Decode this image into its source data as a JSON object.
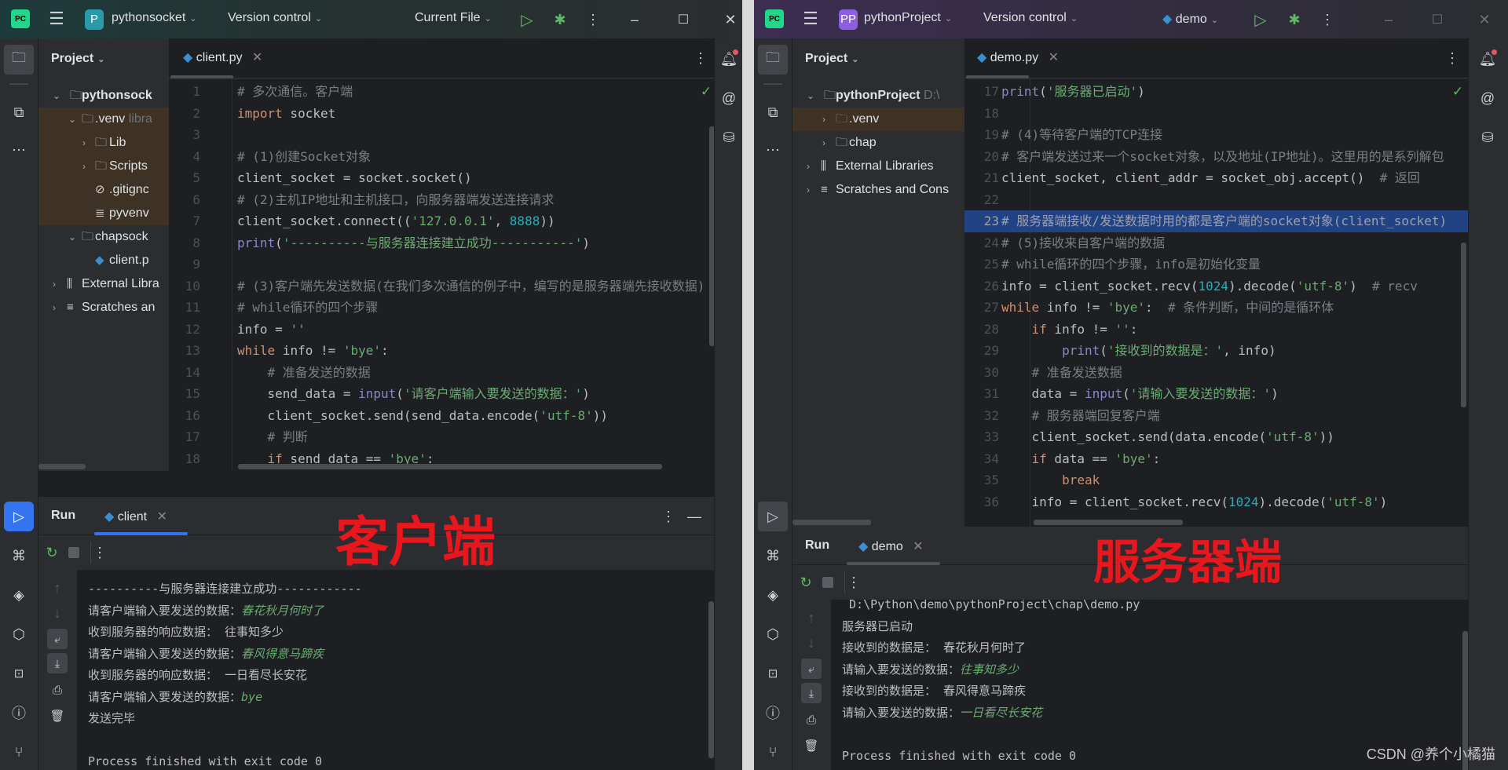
{
  "colors": {
    "keyword": "#cf8e6d",
    "string": "#6aab73",
    "number": "#2aacb8",
    "comment": "#7a7e85",
    "builtin": "#8888c6",
    "annotation": "#e8161d",
    "selection": "#214283"
  },
  "left": {
    "title": {
      "project_badge": "P",
      "project": "pythonsocket",
      "vcs": "Version control",
      "run_config": "Current File"
    },
    "project_panel": {
      "title": "Project",
      "items": [
        {
          "label": "pythonsock",
          "extra": "",
          "icon": "folder-icon"
        },
        {
          "label": ".venv",
          "extra": "libra",
          "icon": "folder-icon"
        },
        {
          "label": "Lib",
          "extra": "",
          "icon": "folder-icon"
        },
        {
          "label": "Scripts",
          "extra": "",
          "icon": "folder-icon"
        },
        {
          "label": ".gitignc",
          "extra": "",
          "icon": "ignore-file-icon"
        },
        {
          "label": "pyvenv",
          "extra": "",
          "icon": "text-file-icon"
        },
        {
          "label": "chapsock",
          "extra": "",
          "icon": "folder-icon"
        },
        {
          "label": "client.p",
          "extra": "",
          "icon": "python-file-icon"
        },
        {
          "label": "External Libra",
          "extra": "",
          "icon": "library-icon"
        },
        {
          "label": "Scratches an",
          "extra": "",
          "icon": "scratches-icon"
        }
      ]
    },
    "tab": "client.py",
    "code": [
      {
        "n": "1",
        "t": [
          [
            "# 多次通信。客户端",
            "cm"
          ]
        ]
      },
      {
        "n": "2",
        "t": [
          [
            "import",
            "kw"
          ],
          [
            " socket",
            ""
          ]
        ]
      },
      {
        "n": "3",
        "t": []
      },
      {
        "n": "4",
        "t": [
          [
            "# (1)创建Socket对象",
            "cm"
          ]
        ]
      },
      {
        "n": "5",
        "t": [
          [
            "client_socket = socket.socket()",
            ""
          ]
        ]
      },
      {
        "n": "6",
        "t": [
          [
            "# (2)主机IP地址和主机接口，向服务器端发送连接请求",
            "cm"
          ]
        ]
      },
      {
        "n": "7",
        "t": [
          [
            "client_socket.connect((",
            ""
          ],
          [
            "'127.0.0.1'",
            "str"
          ],
          [
            ", ",
            ""
          ],
          [
            "8888",
            "num"
          ],
          [
            "))",
            ""
          ]
        ]
      },
      {
        "n": "8",
        "t": [
          [
            "print",
            "bi"
          ],
          [
            "(",
            ""
          ],
          [
            "'----------与服务器连接建立成功-----------'",
            "str"
          ],
          [
            ")",
            ""
          ]
        ]
      },
      {
        "n": "9",
        "t": []
      },
      {
        "n": "10",
        "t": [
          [
            "# (3)客户端先发送数据(在我们多次通信的例子中，编写的是服务器端先接收数据)",
            "cm"
          ]
        ]
      },
      {
        "n": "11",
        "t": [
          [
            "# while循环的四个步骤",
            "cm"
          ]
        ]
      },
      {
        "n": "12",
        "t": [
          [
            "info = ",
            ""
          ],
          [
            "''",
            "str"
          ]
        ]
      },
      {
        "n": "13",
        "t": [
          [
            "while",
            "kw"
          ],
          [
            " info != ",
            ""
          ],
          [
            "'bye'",
            "str"
          ],
          [
            ":",
            ""
          ]
        ]
      },
      {
        "n": "14",
        "t": [
          [
            "    ",
            ""
          ],
          [
            "# 准备发送的数据",
            "cm"
          ]
        ]
      },
      {
        "n": "15",
        "t": [
          [
            "    send_data = ",
            ""
          ],
          [
            "input",
            "bi"
          ],
          [
            "(",
            ""
          ],
          [
            "'请客户端输入要发送的数据：'",
            "str"
          ],
          [
            ")",
            ""
          ]
        ]
      },
      {
        "n": "16",
        "t": [
          [
            "    client_socket.send(send_data.encode(",
            ""
          ],
          [
            "'utf-8'",
            "str"
          ],
          [
            "))",
            ""
          ]
        ]
      },
      {
        "n": "17",
        "t": [
          [
            "    ",
            ""
          ],
          [
            "# 判断",
            "cm"
          ]
        ]
      },
      {
        "n": "18",
        "t": [
          [
            "    ",
            ""
          ],
          [
            "if",
            "kw"
          ],
          [
            " send_data == ",
            ""
          ],
          [
            "'bye'",
            "str"
          ],
          [
            ":",
            ""
          ]
        ]
      }
    ],
    "run": {
      "title": "Run",
      "tab": "client",
      "annotation": "客户端",
      "console": [
        [
          [
            "----------与服务器连接建立成功------------",
            ""
          ]
        ],
        [
          [
            "请客户端输入要发送的数据：",
            ""
          ],
          [
            "春花秋月何时了",
            "inp"
          ]
        ],
        [
          [
            "收到服务器的响应数据： 往事知多少",
            ""
          ]
        ],
        [
          [
            "请客户端输入要发送的数据：",
            ""
          ],
          [
            "春风得意马蹄疾",
            "inp"
          ]
        ],
        [
          [
            "收到服务器的响应数据： 一日看尽长安花",
            ""
          ]
        ],
        [
          [
            "请客户端输入要发送的数据：",
            ""
          ],
          [
            "bye",
            "inp"
          ]
        ],
        [
          [
            "发送完毕",
            ""
          ]
        ],
        [],
        [
          [
            "Process finished with exit code 0",
            ""
          ]
        ]
      ]
    }
  },
  "right": {
    "title": {
      "project_badge": "PP",
      "project": "pythonProject",
      "vcs": "Version control",
      "run_config": "demo"
    },
    "project_panel": {
      "title": "Project",
      "items": [
        {
          "label": "pythonProject",
          "extra": "D:\\",
          "icon": "folder-icon"
        },
        {
          "label": ".venv",
          "extra": "",
          "icon": "folder-icon"
        },
        {
          "label": "chap",
          "extra": "",
          "icon": "folder-icon"
        },
        {
          "label": "External Libraries",
          "extra": "",
          "icon": "library-icon"
        },
        {
          "label": "Scratches and Cons",
          "extra": "",
          "icon": "scratches-icon"
        }
      ]
    },
    "tab": "demo.py",
    "code": [
      {
        "n": "17",
        "t": [
          [
            "print",
            "bi"
          ],
          [
            "(",
            ""
          ],
          [
            "'服务器已启动'",
            "str"
          ],
          [
            ")",
            ""
          ]
        ]
      },
      {
        "n": "18",
        "t": []
      },
      {
        "n": "19",
        "t": [
          [
            "# (4)等待客户端的TCP连接",
            "cm"
          ]
        ]
      },
      {
        "n": "20",
        "t": [
          [
            "# 客户端发送过来一个socket对象，以及地址(IP地址)。这里用的是系列解包",
            "cm"
          ]
        ]
      },
      {
        "n": "21",
        "t": [
          [
            "client_socket, client_addr = socket_obj.accept()  ",
            ""
          ],
          [
            "# 返回",
            "cm"
          ]
        ]
      },
      {
        "n": "22",
        "t": []
      },
      {
        "n": "23",
        "sel": true,
        "t": [
          [
            "# 服务器端接收/发送数据时用的都是客户端的socket对象(client_socket)",
            "cm"
          ]
        ]
      },
      {
        "n": "24",
        "t": [
          [
            "# (5)接收来自客户端的数据",
            "cm"
          ]
        ]
      },
      {
        "n": "25",
        "t": [
          [
            "# while循环的四个步骤，info是初始化变量",
            "cm"
          ]
        ]
      },
      {
        "n": "26",
        "t": [
          [
            "info = client_socket.recv(",
            ""
          ],
          [
            "1024",
            "num"
          ],
          [
            ").decode(",
            ""
          ],
          [
            "'utf-8'",
            "str"
          ],
          [
            ")  ",
            ""
          ],
          [
            "# recv",
            "cm"
          ]
        ]
      },
      {
        "n": "27",
        "t": [
          [
            "while",
            "kw"
          ],
          [
            " info != ",
            ""
          ],
          [
            "'bye'",
            "str"
          ],
          [
            ":  ",
            ""
          ],
          [
            "# 条件判断，中间的是循环体",
            "cm"
          ]
        ]
      },
      {
        "n": "28",
        "t": [
          [
            "    ",
            ""
          ],
          [
            "if",
            "kw"
          ],
          [
            " info != ",
            ""
          ],
          [
            "''",
            "str"
          ],
          [
            ":",
            ""
          ]
        ]
      },
      {
        "n": "29",
        "t": [
          [
            "        ",
            ""
          ],
          [
            "print",
            "bi"
          ],
          [
            "(",
            ""
          ],
          [
            "'接收到的数据是：'",
            "str"
          ],
          [
            ", info)",
            ""
          ]
        ]
      },
      {
        "n": "30",
        "t": [
          [
            "    ",
            ""
          ],
          [
            "# 准备发送数据",
            "cm"
          ]
        ]
      },
      {
        "n": "31",
        "t": [
          [
            "    data = ",
            ""
          ],
          [
            "input",
            "bi"
          ],
          [
            "(",
            ""
          ],
          [
            "'请输入要发送的数据：'",
            "str"
          ],
          [
            ")",
            ""
          ]
        ]
      },
      {
        "n": "32",
        "t": [
          [
            "    ",
            ""
          ],
          [
            "# 服务器端回复客户端",
            "cm"
          ]
        ]
      },
      {
        "n": "33",
        "t": [
          [
            "    client_socket.send(data.encode(",
            ""
          ],
          [
            "'utf-8'",
            "str"
          ],
          [
            "))",
            ""
          ]
        ]
      },
      {
        "n": "34",
        "t": [
          [
            "    ",
            ""
          ],
          [
            "if",
            "kw"
          ],
          [
            " data == ",
            ""
          ],
          [
            "'bye'",
            "str"
          ],
          [
            ":",
            ""
          ]
        ]
      },
      {
        "n": "35",
        "t": [
          [
            "        ",
            ""
          ],
          [
            "break",
            "kw"
          ]
        ]
      },
      {
        "n": "36",
        "t": [
          [
            "    info = client_socket.recv(",
            ""
          ],
          [
            "1024",
            "num"
          ],
          [
            ").decode(",
            ""
          ],
          [
            "'utf-8'",
            "str"
          ],
          [
            ")",
            ""
          ]
        ]
      }
    ],
    "run": {
      "title": "Run",
      "tab": "demo",
      "annotation": "服务器端",
      "console": [
        [
          [
            " D:\\Python\\demo\\pythonProject\\chap\\demo.py",
            ""
          ]
        ],
        [
          [
            "服务器已启动",
            ""
          ]
        ],
        [
          [
            "接收到的数据是： 春花秋月何时了",
            ""
          ]
        ],
        [
          [
            "请输入要发送的数据：",
            ""
          ],
          [
            "往事知多少",
            "inp"
          ]
        ],
        [
          [
            "接收到的数据是： 春风得意马蹄疾",
            ""
          ]
        ],
        [
          [
            "请输入要发送的数据：",
            ""
          ],
          [
            "一日看尽长安花",
            "inp"
          ]
        ],
        [],
        [
          [
            "Process finished with exit code 0",
            ""
          ]
        ]
      ]
    },
    "watermark": "CSDN @养个小橘猫"
  }
}
